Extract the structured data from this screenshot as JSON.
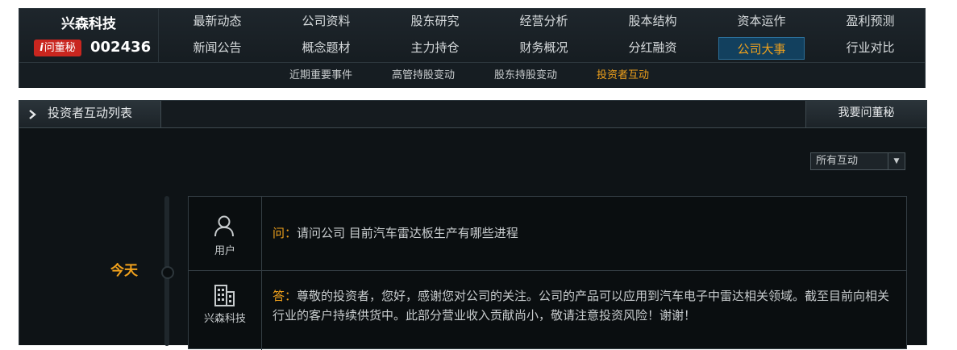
{
  "company": {
    "name": "兴森科技",
    "ask_badge": "问董秘",
    "ask_badge_mark": "i",
    "stock_code": "002436"
  },
  "menu": {
    "row1": [
      "最新动态",
      "公司资料",
      "股东研究",
      "经营分析",
      "股本结构",
      "资本运作",
      "盈利预测"
    ],
    "row2": [
      "新闻公告",
      "概念题材",
      "主力持仓",
      "财务概况",
      "分红融资",
      "公司大事",
      "行业对比"
    ],
    "active": "公司大事"
  },
  "submenu": {
    "items": [
      "近期重要事件",
      "高管持股变动",
      "股东持股变动",
      "投资者互动"
    ],
    "active": "投资者互动"
  },
  "panel": {
    "title": "投资者互动列表",
    "ask_button": "我要问董秘",
    "filter_value": "所有互动",
    "filter_arrow": "▼"
  },
  "timeline": {
    "date_label": "今天"
  },
  "qa": {
    "question_author": "用户",
    "question_tag": "问：",
    "question_text": "请问公司 目前汽车雷达板生产有哪些进程",
    "answer_author": "兴森科技",
    "answer_tag": "答：",
    "answer_text": "尊敬的投资者，您好，感谢您对公司的关注。公司的产品可以应用到汽车电子中雷达相关领域。截至目前向相关行业的客户持续供货中。此部分营业收入贡献尚小，敬请注意投资风险！谢谢！"
  },
  "colors": {
    "accent": "#f0a11c",
    "badge": "#c9261f",
    "active_tab_bg": "#12405e"
  },
  "icons": [
    "chevron-right-icon",
    "user-icon",
    "building-icon",
    "dropdown-arrow-icon"
  ]
}
